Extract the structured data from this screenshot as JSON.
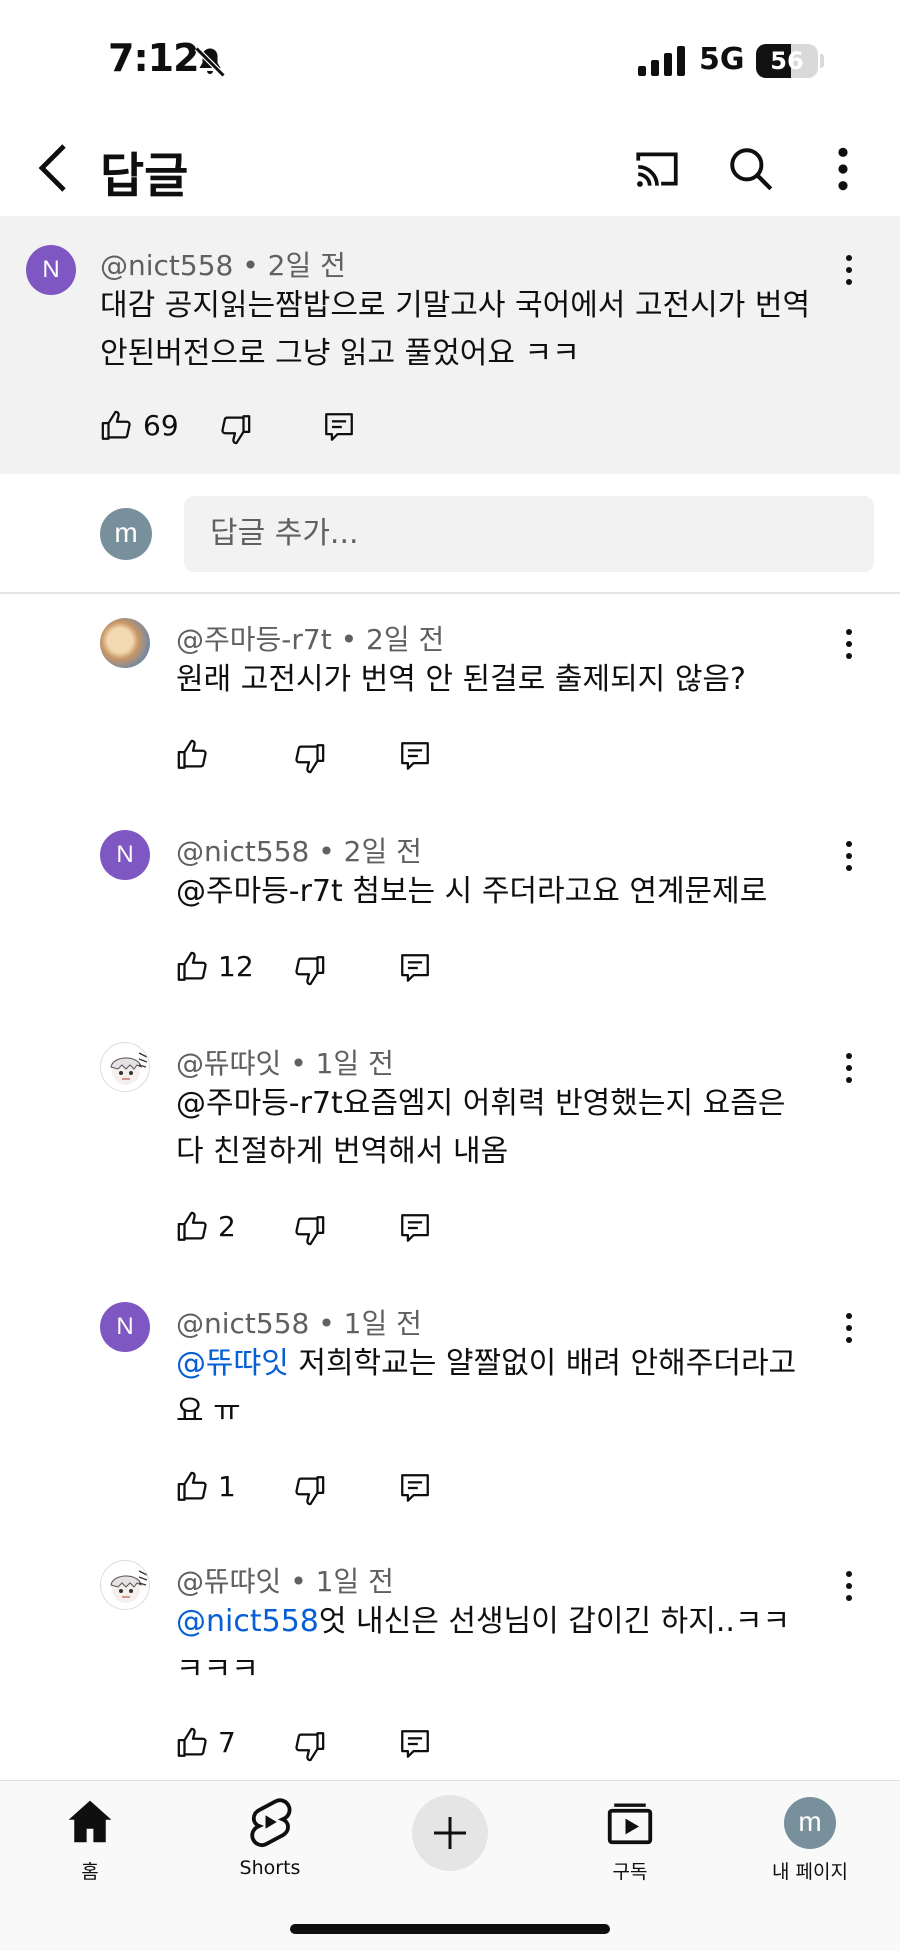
{
  "status_bar": {
    "time": "7:12",
    "network": "5G",
    "battery": "56",
    "battery_level": 0.56
  },
  "header": {
    "title": "답글"
  },
  "parent_comment": {
    "author": "@nict558",
    "time": "2일 전",
    "avatar_letter": "N",
    "text_line1": "대감 공지읽는짬밥으로 기말고사 국어에서 고전시가 번역",
    "text_line2": "안된버전으로 그냥 읽고 풀었어요 ㅋㅋ",
    "likes": "69"
  },
  "add_reply": {
    "avatar_letter": "m",
    "placeholder": "답글 추가..."
  },
  "replies": [
    {
      "author": "@주마등-r7t",
      "time": "2일 전",
      "mention": "",
      "text_line1": "원래 고전시가 번역 안 된걸로 출제되지 않음?",
      "text_line2": "",
      "likes": ""
    },
    {
      "author": "@nict558",
      "time": "2일 전",
      "avatar_letter": "N",
      "mention": "",
      "text_line1": "@주마등-r7t 첨보는 시 주더라고요 연계문제로",
      "text_line2": "",
      "likes": "12"
    },
    {
      "author": "@뜌땨잇",
      "time": "1일 전",
      "mention": "",
      "text_line1": "@주마등-r7t요즘엠지 어휘력 반영했는지 요즘은",
      "text_line2": "다 친절하게 번역해서 내옴",
      "likes": "2"
    },
    {
      "author": "@nict558",
      "time": "1일 전",
      "avatar_letter": "N",
      "mention": "@뜌땨잇",
      "text_line1": " 저희학교는 얄짤없이 배려 안해주더라고",
      "text_line2": "요 ㅠ",
      "likes": "1"
    },
    {
      "author": "@뜌땨잇",
      "time": "1일 전",
      "mention": "@nict558",
      "text_line1": "엇 내신은 선생님이 갑이긴 하지..ㅋㅋ",
      "text_line2": "ㅋㅋㅋ",
      "likes": "7"
    }
  ],
  "meta_separator": "•",
  "bottom_nav": {
    "home": "홈",
    "shorts": "Shorts",
    "subscriptions": "구독",
    "my_page": "내 페이지",
    "avatar_letter": "m"
  }
}
